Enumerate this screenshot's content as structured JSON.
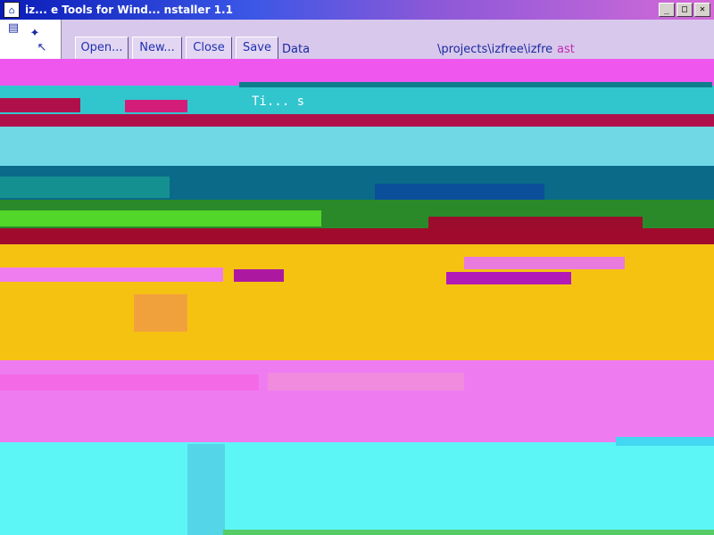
{
  "window": {
    "title": "iz... e Tools for Wind... nstaller 1.1",
    "app_icon": "installer-app-icon",
    "controls": {
      "minimize": "_",
      "maximize": "□",
      "close": "✕"
    }
  },
  "toolbar": {
    "buttons": [
      "Open...",
      "New...",
      "Close",
      "Save"
    ],
    "data_label": "Data",
    "path_text": "\\projects\\izfree\\izfre",
    "path_tail": "ast"
  },
  "content": {
    "overlay_text": "Ti... s"
  },
  "colors": {
    "title_gradient_start": "#0a1cb8",
    "toolbar_bg": "#d8c8ec",
    "button_text": "#2030b0",
    "magenta_band": "#ee56ee",
    "teal_band": "#31c6ce",
    "crimson_band": "#b0104a",
    "green_band": "#2a8a2a",
    "yellow_band": "#f6c212",
    "pink_band": "#ee7cf0",
    "cyan_band": "#5cf6f6"
  },
  "icons": [
    "installer-app-icon",
    "minimize-icon",
    "maximize-icon",
    "close-icon",
    "folder-icon",
    "wizard-icon",
    "cursor-icon"
  ]
}
